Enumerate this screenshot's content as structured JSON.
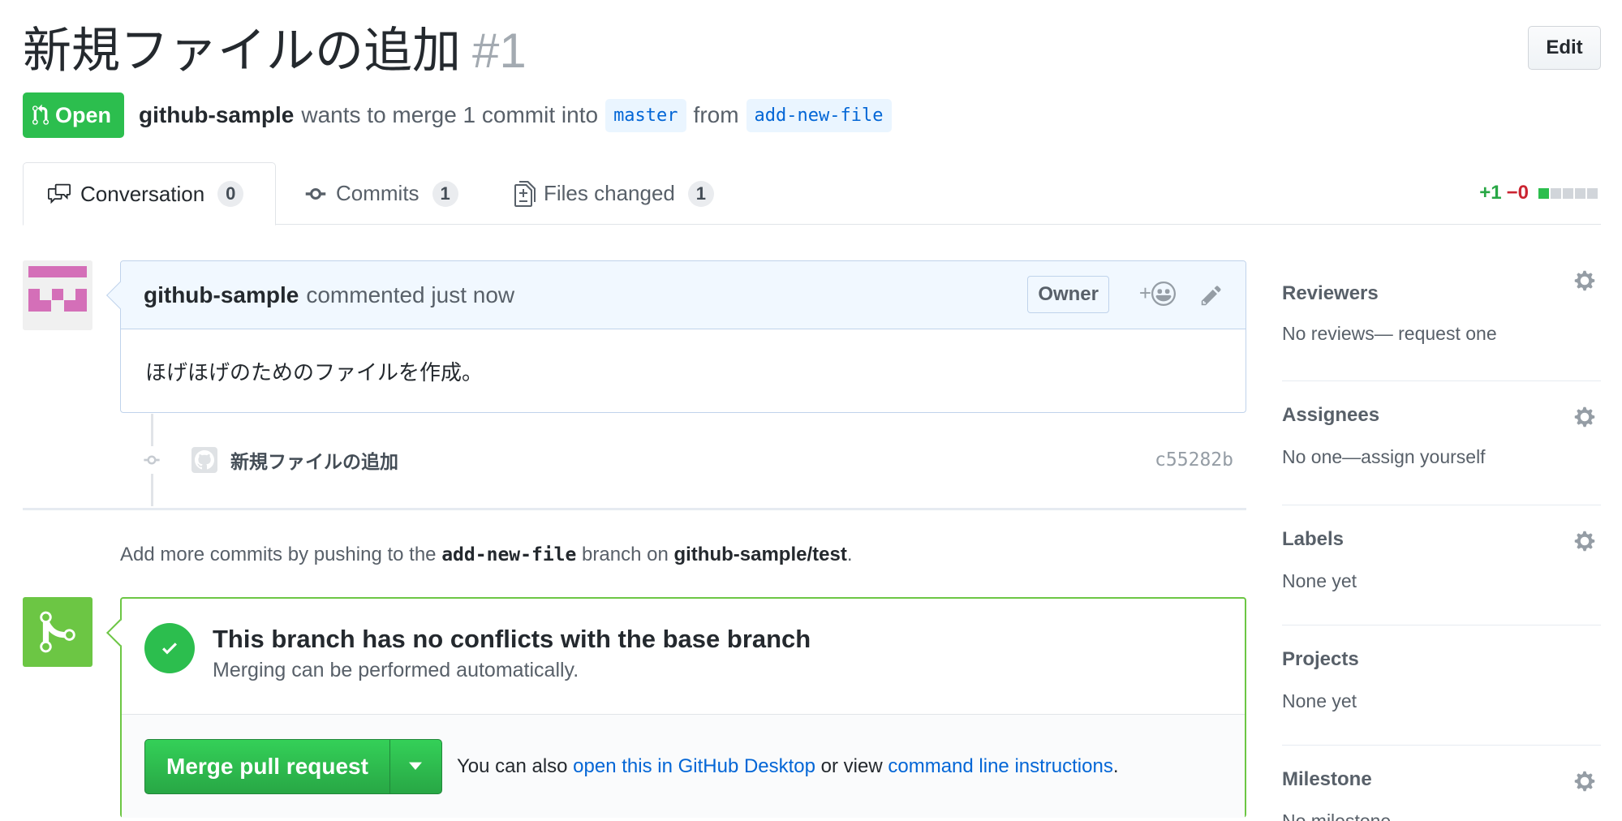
{
  "pr": {
    "title": "新規ファイルの追加",
    "number": "#1",
    "edit_label": "Edit",
    "state": "Open",
    "author": "github-sample",
    "merge_text": "wants to merge 1 commit into",
    "base_branch": "master",
    "from_text": "from",
    "head_branch": "add-new-file"
  },
  "tabs": [
    {
      "label": "Conversation",
      "count": "0",
      "icon": "comment-discussion-icon"
    },
    {
      "label": "Commits",
      "count": "1",
      "icon": "git-commit-icon"
    },
    {
      "label": "Files changed",
      "count": "1",
      "icon": "file-diff-icon"
    }
  ],
  "diffstat": {
    "added": "+1",
    "removed": "−0",
    "blocks": [
      "#2cbe4e",
      "#d1d5da",
      "#d1d5da",
      "#d1d5da",
      "#d1d5da"
    ]
  },
  "comment": {
    "author": "github-sample",
    "action": "commented just now",
    "owner_label": "Owner",
    "reaction_plus": "+",
    "body": "ほげほげのためのファイルを作成。"
  },
  "commit": {
    "message": "新規ファイルの追加",
    "sha": "c55282b"
  },
  "hint": {
    "prefix": "Add more commits by pushing to the",
    "branch": "add-new-file",
    "middle": "branch on",
    "repo": "github-sample/test",
    "suffix": "."
  },
  "merge": {
    "title": "This branch has no conflicts with the base branch",
    "subtitle": "Merging can be performed automatically.",
    "button_label": "Merge pull request",
    "alt_prefix": "You can also",
    "alt_link1": "open this in GitHub Desktop",
    "alt_middle": "or view",
    "alt_link2": "command line instructions",
    "alt_suffix": "."
  },
  "sidebar": [
    {
      "heading": "Reviewers",
      "value": "No reviews— request one",
      "gear": true
    },
    {
      "heading": "Assignees",
      "value": "No one—assign yourself",
      "gear": true
    },
    {
      "heading": "Labels",
      "value": "None yet",
      "gear": true
    },
    {
      "heading": "Projects",
      "value": "None yet",
      "gear": false
    },
    {
      "heading": "Milestone",
      "value": "No milestone",
      "gear": true
    }
  ],
  "colors": {
    "open_green": "#2cbe4e",
    "merge_green": "#6cc644",
    "link_blue": "#0366d6",
    "avatar_pink": "#d46fb8"
  }
}
